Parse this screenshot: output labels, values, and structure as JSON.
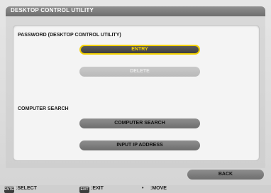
{
  "window": {
    "title": "DESKTOP CONTROL UTILITY"
  },
  "password_section": {
    "label": "PASSWORD (DESKTOP CONTROL UTILITY)",
    "entry_button": "ENTRY",
    "delete_button": "DELETE"
  },
  "computer_search_section": {
    "label": "COMPUTER SEARCH",
    "computer_search_button": "COMPUTER SEARCH",
    "input_ip_button": "INPUT IP ADDRESS"
  },
  "footer": {
    "back_button": "BACK"
  },
  "statusbar": {
    "enter_key": "ENTER",
    "select_hint": ":SELECT",
    "exit_key": "EXIT",
    "exit_hint": ":EXIT",
    "move_symbol": "•",
    "move_hint": ":MOVE"
  },
  "colors": {
    "selected_highlight": "#f2d000",
    "button_dark": "#7a7a7a",
    "button_disabled": "#c2c2c2",
    "titlebar": "#7d7d7d"
  }
}
